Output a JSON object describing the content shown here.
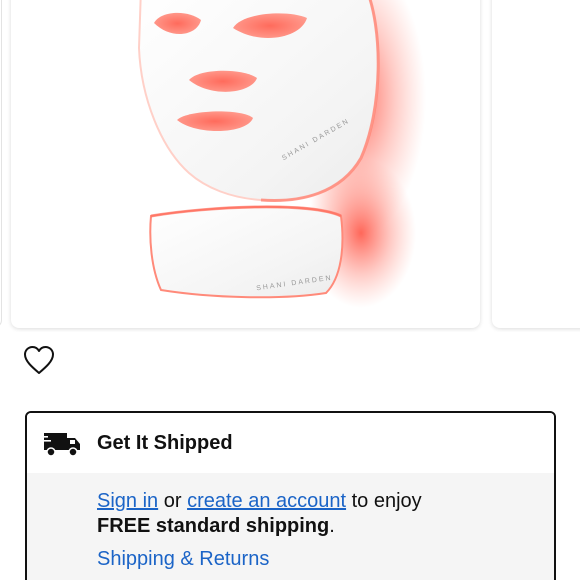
{
  "product": {
    "brand_on_mask": "SHANI DARDEN",
    "brand_on_neck": "SHANI DARDEN",
    "image_icon": "led-light-mask-image"
  },
  "wishlist": {
    "icon": "heart-outline-icon"
  },
  "shipping": {
    "icon": "delivery-truck-icon",
    "title": "Get It Shipped",
    "sign_in": "Sign in",
    "or": " or ",
    "create_account": "create an account",
    "to_enjoy": " to enjoy",
    "free_shipping": "FREE standard shipping",
    "period": ".",
    "shipping_returns": "Shipping & Returns"
  },
  "colors": {
    "link": "#1b64c7",
    "glow": "#ff5a4a",
    "panel": "#f5f5f5",
    "border": "#111111"
  }
}
